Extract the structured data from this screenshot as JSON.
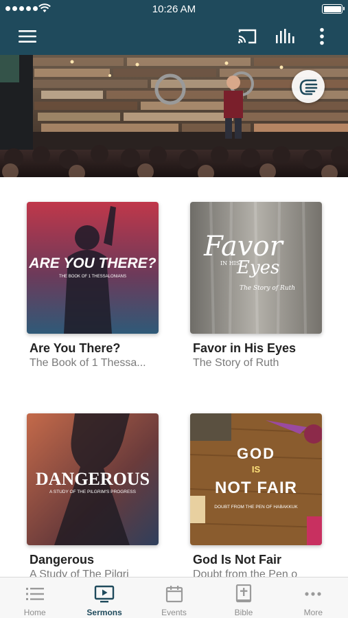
{
  "status_bar": {
    "time": "10:26 AM"
  },
  "colors": {
    "brand": "#1f4a5c",
    "tab_inactive": "#8d8d8d",
    "title": "#222222",
    "subtitle": "#7a7a7a"
  },
  "nav": {
    "icons": [
      "hamburger-menu-icon",
      "cast-icon",
      "audio-bars-icon",
      "vertical-dots-icon"
    ]
  },
  "hero": {
    "fab_icon": "hand-wave-icon"
  },
  "series": [
    {
      "title": "Are You There?",
      "subtitle": "The Book of 1 Thessa...",
      "art_title": "ARE YOU THERE?",
      "art_subtitle": "THE BOOK OF 1 THESSALONIANS"
    },
    {
      "title": "Favor in His Eyes",
      "subtitle": "The Story of Ruth",
      "art_title_1": "Favor",
      "art_title_2": "IN HIS",
      "art_title_3": "Eyes",
      "art_subtitle": "The Story of Ruth"
    },
    {
      "title": "Dangerous",
      "subtitle": "A Study of The Pilgri",
      "art_title": "DANGEROUS",
      "art_subtitle": "A STUDY OF THE PILGRIM'S PROGRESS"
    },
    {
      "title": "God Is Not Fair",
      "subtitle": "Doubt from the Pen o",
      "art_letters_1": "GOD",
      "art_letters_2": "IS",
      "art_letters_3": "NOT FAIR",
      "art_subtitle": "DOUBT FROM THE PEN OF HABAKKUK"
    }
  ],
  "tabs": [
    {
      "label": "Home",
      "icon": "list-icon",
      "active": false
    },
    {
      "label": "Sermons",
      "icon": "tv-play-icon",
      "active": true
    },
    {
      "label": "Events",
      "icon": "calendar-icon",
      "active": false
    },
    {
      "label": "Bible",
      "icon": "bible-cross-icon",
      "active": false
    },
    {
      "label": "More",
      "icon": "horizontal-dots-icon",
      "active": false
    }
  ]
}
